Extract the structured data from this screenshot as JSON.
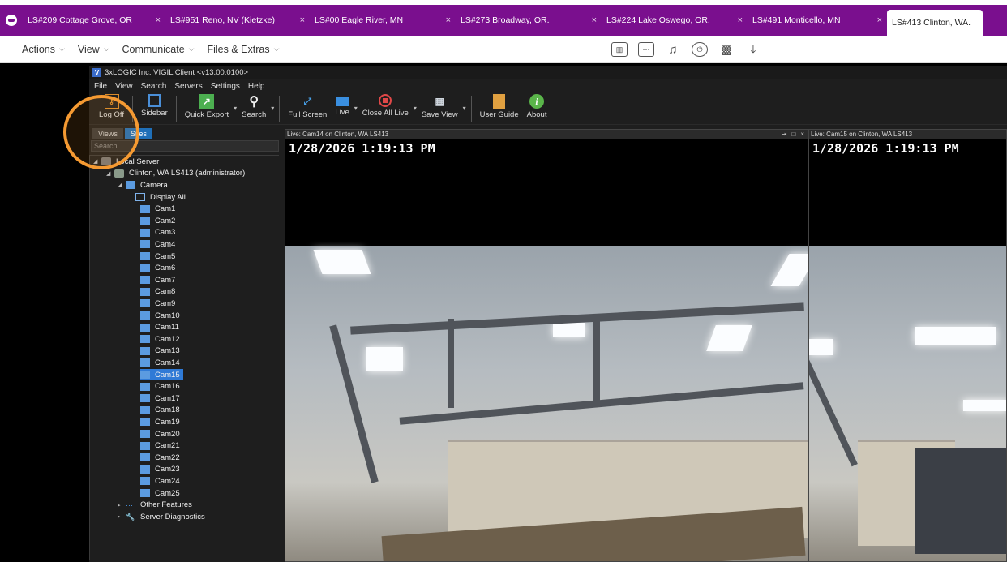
{
  "tabs": [
    {
      "label": "LS#209 Cottage Grove, OR"
    },
    {
      "label": "LS#951 Reno, NV (Kietzke)"
    },
    {
      "label": "LS#00 Eagle River, MN"
    },
    {
      "label": "LS#273 Broadway, OR."
    },
    {
      "label": "LS#224 Lake Oswego, OR."
    },
    {
      "label": "LS#491 Monticello, MN"
    },
    {
      "label": "LS#413 Clinton, WA."
    }
  ],
  "tab_close": "×",
  "menubar": {
    "items": [
      "Actions",
      "View",
      "Communicate",
      "Files & Extras"
    ],
    "chevron": "⌵"
  },
  "toolicons": [
    "chart-icon",
    "ticket-icon",
    "sound-file-icon",
    "power-icon",
    "pattern-icon",
    "download-icon"
  ],
  "client": {
    "title": "3xLOGIC Inc. VIGIL Client <v13.00.0100>",
    "menu": [
      "File",
      "View",
      "Search",
      "Servers",
      "Settings",
      "Help"
    ],
    "ribbon": {
      "log_off": "Log Off",
      "sidebar": "Sidebar",
      "quick_export": "Quick Export",
      "search": "Search",
      "full_screen": "Full Screen",
      "live": "Live",
      "close_all_live": "Close All Live",
      "save_view": "Save View",
      "user_guide": "User Guide",
      "about": "About"
    },
    "sidebar_tabs": {
      "views": "Views",
      "sites": "Sites"
    },
    "search_placeholder": "Search",
    "tree": {
      "local_server": "Local Server",
      "site": "Clinton, WA LS413 (administrator)",
      "camera_group": "Camera",
      "display_all": "Display All",
      "cameras": [
        "Cam1",
        "Cam2",
        "Cam3",
        "Cam4",
        "Cam5",
        "Cam6",
        "Cam7",
        "Cam8",
        "Cam9",
        "Cam10",
        "Cam11",
        "Cam12",
        "Cam13",
        "Cam14",
        "Cam15",
        "Cam16",
        "Cam17",
        "Cam18",
        "Cam19",
        "Cam20",
        "Cam21",
        "Cam22",
        "Cam23",
        "Cam24",
        "Cam25"
      ],
      "selected_camera": "Cam15",
      "other_features": "Other Features",
      "server_diagnostics": "Server Diagnostics"
    },
    "panels": [
      {
        "header": "Live: Cam14 on Clinton, WA LS413",
        "timestamp": "1/28/2026 1:19:13 PM"
      },
      {
        "header": "Live: Cam15 on Clinton, WA LS413",
        "timestamp": "1/28/2026 1:19:13 PM"
      }
    ]
  },
  "colors": {
    "tabbar": "#7a0f8e",
    "highlight": "#f59a32",
    "selection": "#2f7ad6"
  }
}
